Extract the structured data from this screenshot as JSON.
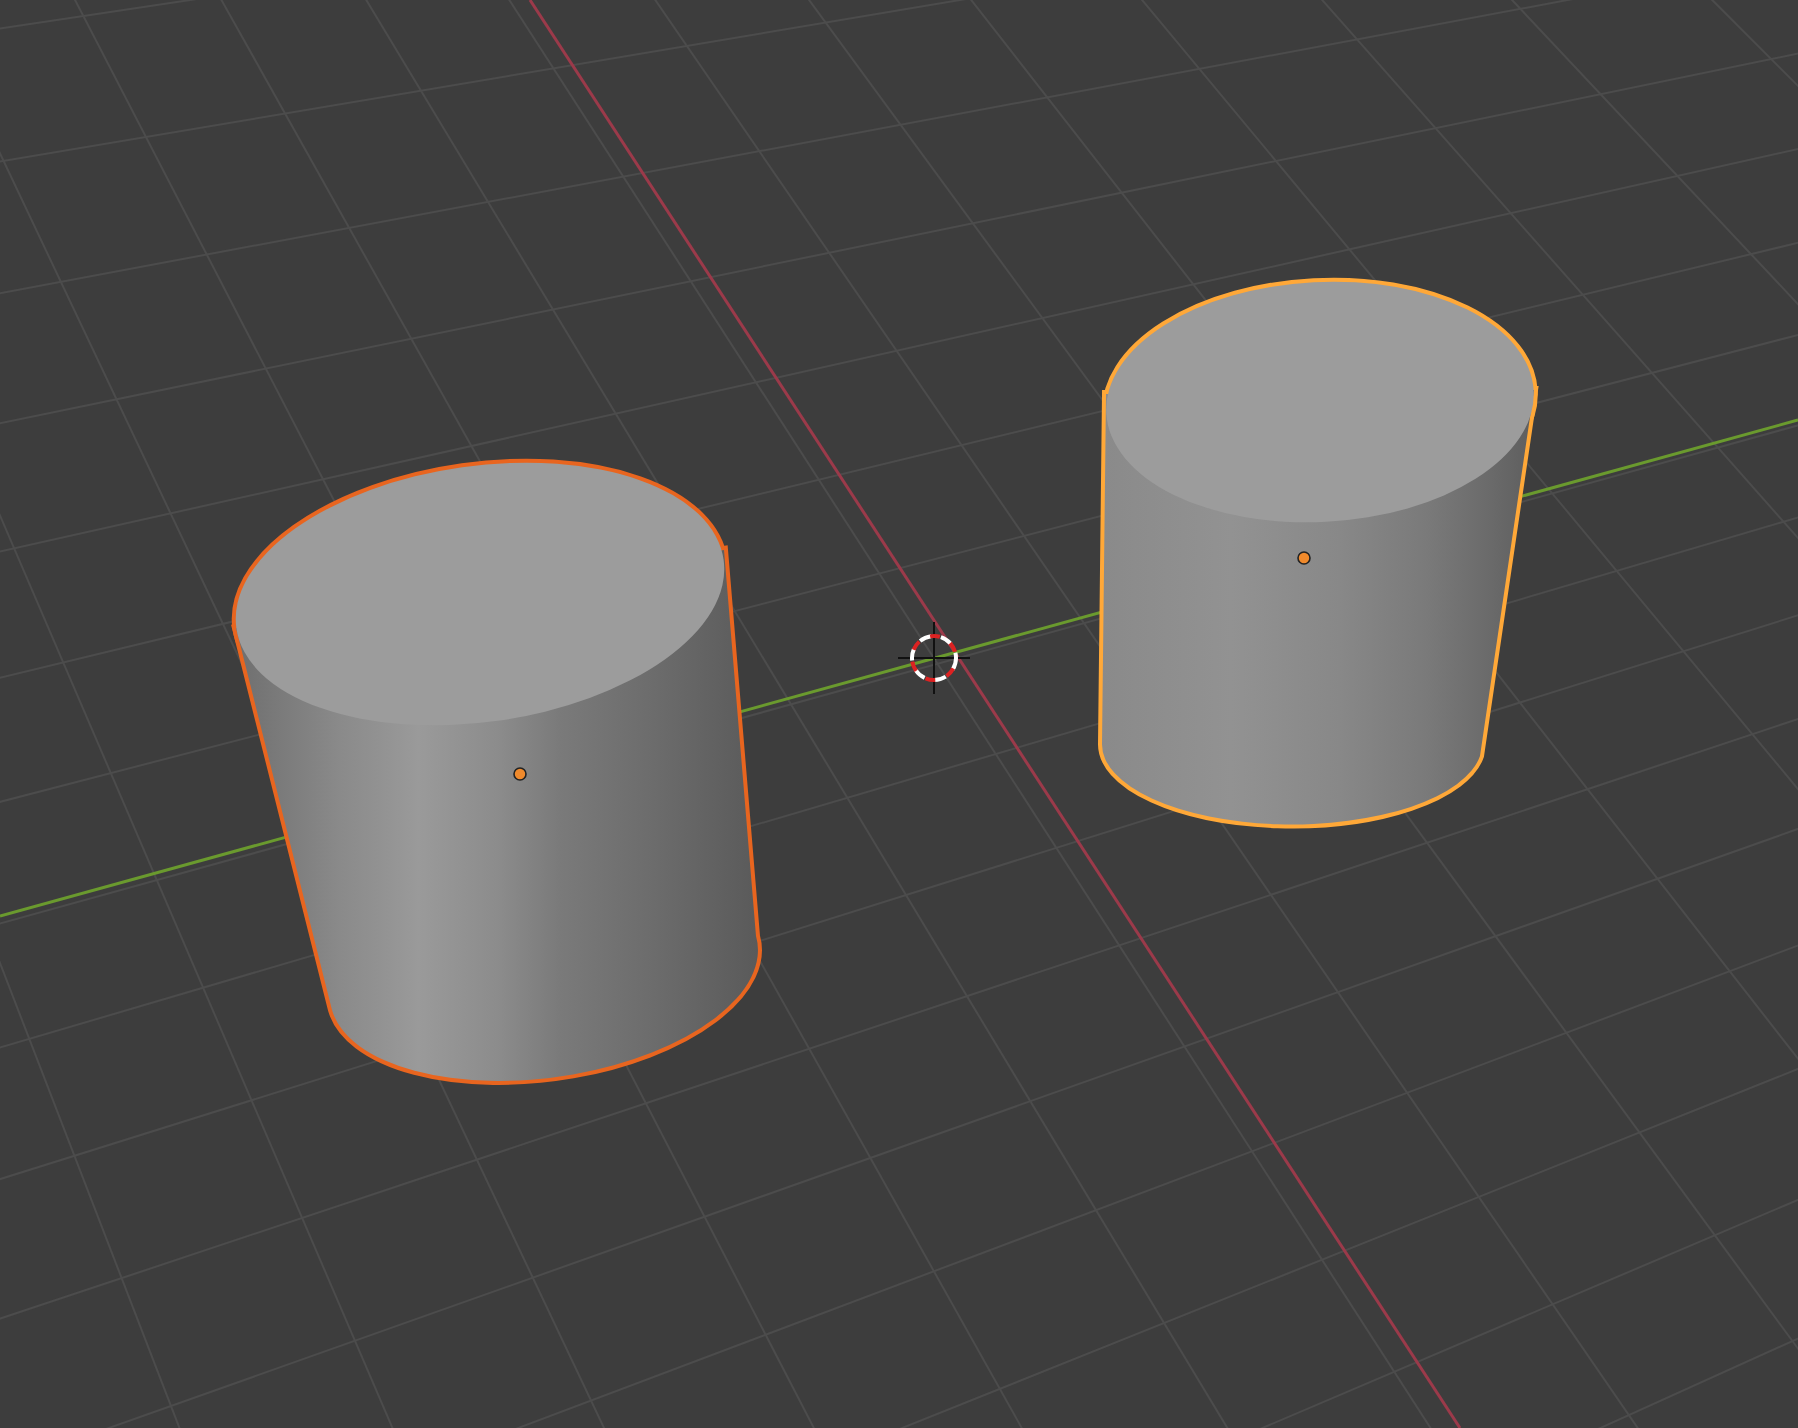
{
  "viewport": {
    "objects": [
      {
        "kind": "cylinder",
        "selected": true,
        "active": false
      },
      {
        "kind": "cylinder",
        "selected": true,
        "active": true
      }
    ]
  }
}
